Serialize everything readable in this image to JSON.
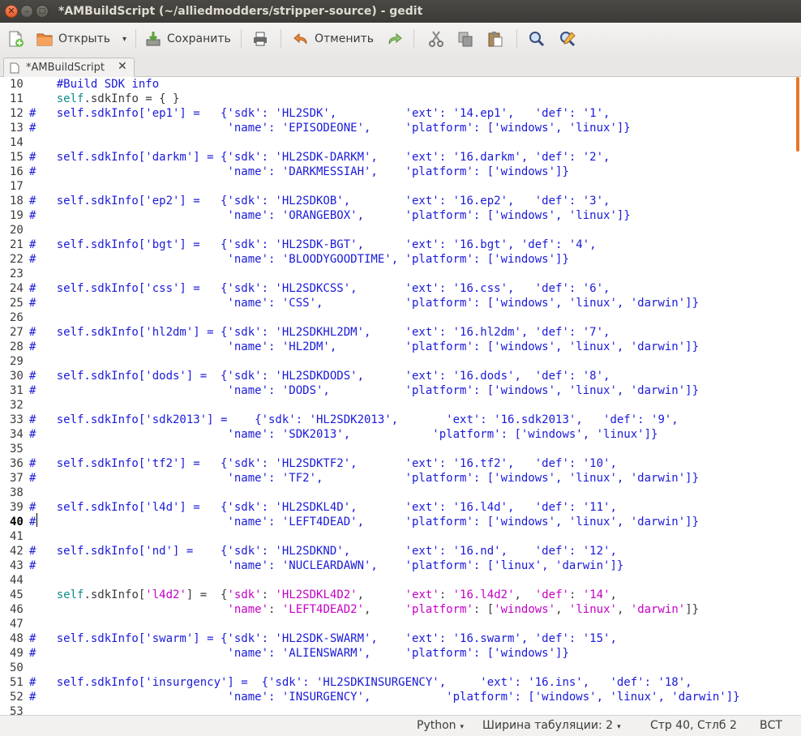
{
  "window": {
    "title": "*AMBuildScript (~/alliedmodders/stripper-source) - gedit",
    "close_glyph": "✕",
    "minimize_glyph": "–",
    "maximize_glyph": "□"
  },
  "toolbar": {
    "open_label": "Открыть",
    "save_label": "Сохранить",
    "undo_label": "Отменить",
    "dropdown_glyph": "▾",
    "icons": [
      "new-document-icon",
      "open-folder-icon",
      "save-icon",
      "print-icon",
      "undo-icon",
      "redo-icon",
      "cut-icon",
      "copy-icon",
      "paste-icon",
      "find-icon",
      "find-replace-icon"
    ]
  },
  "tab": {
    "label": "*AMBuildScript",
    "close_glyph": "✕"
  },
  "editor": {
    "current_line": 40,
    "lines": [
      {
        "n": "10",
        "segs": [
          [
            "plain",
            "    "
          ],
          [
            "cm",
            "#Build SDK info"
          ]
        ]
      },
      {
        "n": "11",
        "segs": [
          [
            "plain",
            "    "
          ],
          [
            "self",
            "self"
          ],
          [
            "plain",
            ".sdkInfo = { }"
          ]
        ]
      },
      {
        "n": "12",
        "segs": [
          [
            "cm",
            "#   self.sdkInfo['ep1'] =   {'sdk': 'HL2SDK',          'ext': '14.ep1',   'def': '1',"
          ]
        ]
      },
      {
        "n": "13",
        "segs": [
          [
            "cm",
            "#                            'name': 'EPISODEONE',     'platform': ['windows', 'linux']}"
          ]
        ]
      },
      {
        "n": "14",
        "segs": []
      },
      {
        "n": "15",
        "segs": [
          [
            "cm",
            "#   self.sdkInfo['darkm'] = {'sdk': 'HL2SDK-DARKM',    'ext': '16.darkm', 'def': '2',"
          ]
        ]
      },
      {
        "n": "16",
        "segs": [
          [
            "cm",
            "#                            'name': 'DARKMESSIAH',    'platform': ['windows']}"
          ]
        ]
      },
      {
        "n": "17",
        "segs": []
      },
      {
        "n": "18",
        "segs": [
          [
            "cm",
            "#   self.sdkInfo['ep2'] =   {'sdk': 'HL2SDKOB',        'ext': '16.ep2',   'def': '3',"
          ]
        ]
      },
      {
        "n": "19",
        "segs": [
          [
            "cm",
            "#                            'name': 'ORANGEBOX',      'platform': ['windows', 'linux']}"
          ]
        ]
      },
      {
        "n": "20",
        "segs": []
      },
      {
        "n": "21",
        "segs": [
          [
            "cm",
            "#   self.sdkInfo['bgt'] =   {'sdk': 'HL2SDK-BGT',      'ext': '16.bgt', 'def': '4',"
          ]
        ]
      },
      {
        "n": "22",
        "segs": [
          [
            "cm",
            "#                            'name': 'BLOODYGOODTIME', 'platform': ['windows']}"
          ]
        ]
      },
      {
        "n": "23",
        "segs": []
      },
      {
        "n": "24",
        "segs": [
          [
            "cm",
            "#   self.sdkInfo['css'] =   {'sdk': 'HL2SDKCSS',       'ext': '16.css',   'def': '6',"
          ]
        ]
      },
      {
        "n": "25",
        "segs": [
          [
            "cm",
            "#                            'name': 'CSS',            'platform': ['windows', 'linux', 'darwin']}"
          ]
        ]
      },
      {
        "n": "26",
        "segs": []
      },
      {
        "n": "27",
        "segs": [
          [
            "cm",
            "#   self.sdkInfo['hl2dm'] = {'sdk': 'HL2SDKHL2DM',     'ext': '16.hl2dm', 'def': '7',"
          ]
        ]
      },
      {
        "n": "28",
        "segs": [
          [
            "cm",
            "#                            'name': 'HL2DM',          'platform': ['windows', 'linux', 'darwin']}"
          ]
        ]
      },
      {
        "n": "29",
        "segs": []
      },
      {
        "n": "30",
        "segs": [
          [
            "cm",
            "#   self.sdkInfo['dods'] =  {'sdk': 'HL2SDKDODS',      'ext': '16.dods',  'def': '8',"
          ]
        ]
      },
      {
        "n": "31",
        "segs": [
          [
            "cm",
            "#                            'name': 'DODS',           'platform': ['windows', 'linux', 'darwin']}"
          ]
        ]
      },
      {
        "n": "32",
        "segs": []
      },
      {
        "n": "33",
        "segs": [
          [
            "cm",
            "#   self.sdkInfo['sdk2013'] =    {'sdk': 'HL2SDK2013',       'ext': '16.sdk2013',   'def': '9',"
          ]
        ]
      },
      {
        "n": "34",
        "segs": [
          [
            "cm",
            "#                            'name': 'SDK2013',            'platform': ['windows', 'linux']}"
          ]
        ]
      },
      {
        "n": "35",
        "segs": []
      },
      {
        "n": "36",
        "segs": [
          [
            "cm",
            "#   self.sdkInfo['tf2'] =   {'sdk': 'HL2SDKTF2',       'ext': '16.tf2',   'def': '10',"
          ]
        ]
      },
      {
        "n": "37",
        "segs": [
          [
            "cm",
            "#                            'name': 'TF2',            'platform': ['windows', 'linux', 'darwin']}"
          ]
        ]
      },
      {
        "n": "38",
        "segs": []
      },
      {
        "n": "39",
        "segs": [
          [
            "cm",
            "#   self.sdkInfo['l4d'] =   {'sdk': 'HL2SDKL4D',       'ext': '16.l4d',   'def': '11',"
          ]
        ]
      },
      {
        "n": "40",
        "segs": [
          [
            "cm",
            "#                            'name': 'LEFT4DEAD',      'platform': ['windows', 'linux', 'darwin']}"
          ]
        ]
      },
      {
        "n": "41",
        "segs": []
      },
      {
        "n": "42",
        "segs": [
          [
            "cm",
            "#   self.sdkInfo['nd'] =    {'sdk': 'HL2SDKND',        'ext': '16.nd',    'def': '12',"
          ]
        ]
      },
      {
        "n": "43",
        "segs": [
          [
            "cm",
            "#                            'name': 'NUCLEARDAWN',    'platform': ['linux', 'darwin']}"
          ]
        ]
      },
      {
        "n": "44",
        "segs": []
      },
      {
        "n": "45",
        "segs": [
          [
            "plain",
            "    "
          ],
          [
            "self",
            "self"
          ],
          [
            "plain",
            ".sdkInfo["
          ],
          [
            "str",
            "'l4d2'"
          ],
          [
            "plain",
            "] =  {"
          ],
          [
            "str",
            "'sdk'"
          ],
          [
            "plain",
            ": "
          ],
          [
            "str",
            "'HL2SDKL4D2'"
          ],
          [
            "plain",
            ",      "
          ],
          [
            "str",
            "'ext'"
          ],
          [
            "plain",
            ": "
          ],
          [
            "str",
            "'16.l4d2'"
          ],
          [
            "plain",
            ",  "
          ],
          [
            "str",
            "'def'"
          ],
          [
            "plain",
            ": "
          ],
          [
            "str",
            "'14'"
          ],
          [
            "plain",
            ","
          ]
        ]
      },
      {
        "n": "46",
        "segs": [
          [
            "plain",
            "                             "
          ],
          [
            "str",
            "'name'"
          ],
          [
            "plain",
            ": "
          ],
          [
            "str",
            "'LEFT4DEAD2'"
          ],
          [
            "plain",
            ",     "
          ],
          [
            "str",
            "'platform'"
          ],
          [
            "plain",
            ": ["
          ],
          [
            "str",
            "'windows'"
          ],
          [
            "plain",
            ", "
          ],
          [
            "str",
            "'linux'"
          ],
          [
            "plain",
            ", "
          ],
          [
            "str",
            "'darwin'"
          ],
          [
            "plain",
            "]}"
          ]
        ]
      },
      {
        "n": "47",
        "segs": []
      },
      {
        "n": "48",
        "segs": [
          [
            "cm",
            "#   self.sdkInfo['swarm'] = {'sdk': 'HL2SDK-SWARM',    'ext': '16.swarm', 'def': '15',"
          ]
        ]
      },
      {
        "n": "49",
        "segs": [
          [
            "cm",
            "#                            'name': 'ALIENSWARM',     'platform': ['windows']}"
          ]
        ]
      },
      {
        "n": "50",
        "segs": []
      },
      {
        "n": "51",
        "segs": [
          [
            "cm",
            "#   self.sdkInfo['insurgency'] =  {'sdk': 'HL2SDKINSURGENCY',     'ext': '16.ins',   'def': '18',"
          ]
        ]
      },
      {
        "n": "52",
        "segs": [
          [
            "cm",
            "#                            'name': 'INSURGENCY',           'platform': ['windows', 'linux', 'darwin']}"
          ]
        ]
      },
      {
        "n": "53",
        "segs": []
      }
    ]
  },
  "statusbar": {
    "language": "Python",
    "tab_width": "Ширина табуляции: 2",
    "position": "Стр 40, Стлб 2",
    "insert_mode": "ВСТ",
    "dropdown_glyph": "▾"
  },
  "colors": {
    "comment": "#1a1ad9",
    "self_keyword": "#0e8b8b",
    "string": "#c400c4",
    "scroll_thumb": "#e7772b",
    "titlebar": "#3c3b37"
  }
}
